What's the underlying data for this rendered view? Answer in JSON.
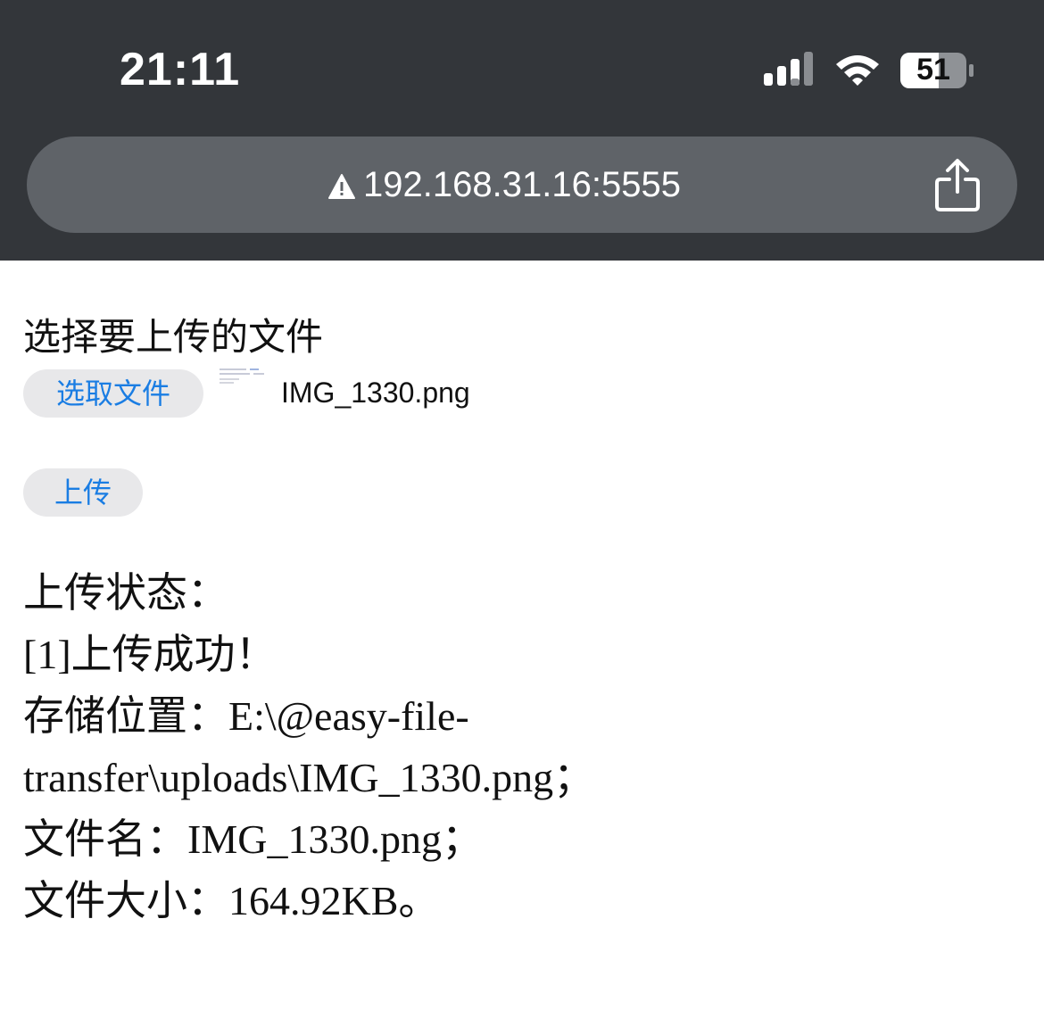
{
  "status_bar": {
    "time": "21:11",
    "battery_level": "51",
    "icons": [
      "signal-icon",
      "wifi-icon",
      "battery-icon"
    ]
  },
  "browser": {
    "url": "192.168.31.16:5555",
    "icons": [
      "warning-icon",
      "share-icon"
    ]
  },
  "upload_form": {
    "section_title": "选择要上传的文件",
    "choose_button_label": "选取文件",
    "selected_file_name": "IMG_1330.png",
    "upload_button_label": "上传"
  },
  "upload_status": {
    "heading": "上传状态：",
    "result": "[1]上传成功！",
    "location_line_1": "存储位置：E:\\@easy-file-",
    "location_line_2": "transfer\\uploads\\IMG_1330.png；",
    "file_name_line": "文件名：IMG_1330.png；",
    "file_size_line": "文件大小：164.92KB。"
  },
  "colors": {
    "status_bar_bg": "#33363a",
    "url_bar_bg": "#5f6368",
    "button_bg": "#e8e8ea",
    "link_blue": "#1a7de3"
  }
}
